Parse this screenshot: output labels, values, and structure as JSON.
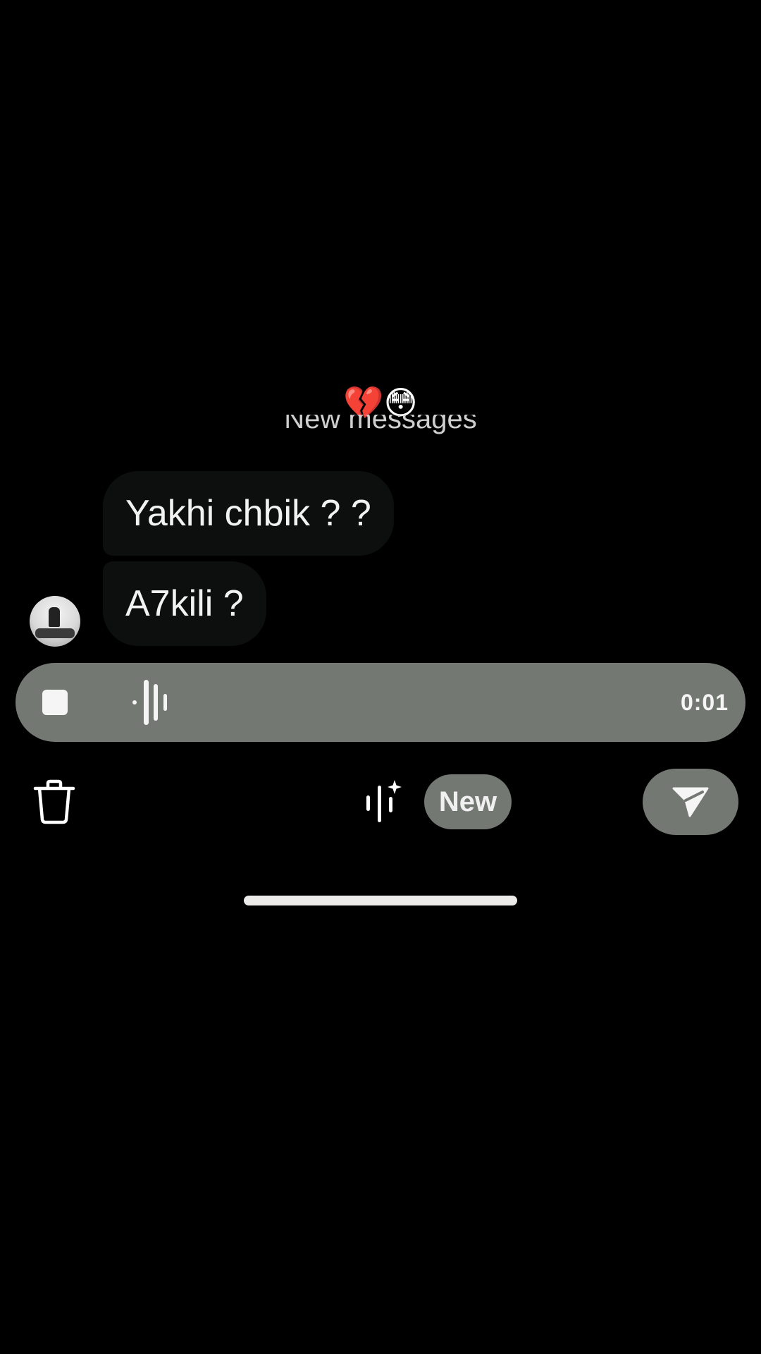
{
  "header": {
    "emoji_reaction": "💔😳",
    "new_messages_label": "New messages"
  },
  "messages": [
    {
      "text": "Yakhi chbik ? ?"
    },
    {
      "text": "A7kili ?"
    }
  ],
  "recorder": {
    "elapsed": "0:01"
  },
  "toolbar": {
    "new_badge": "New"
  },
  "icons": {
    "stop": "stop-icon",
    "waveform": "waveform-icon",
    "trash": "trash-icon",
    "ai_voice": "ai-voice-effects-icon",
    "send": "send-icon"
  },
  "colors": {
    "background": "#000000",
    "bubble": "#0d0f0f",
    "control_gray": "#737873",
    "text": "#f2f2f2"
  }
}
